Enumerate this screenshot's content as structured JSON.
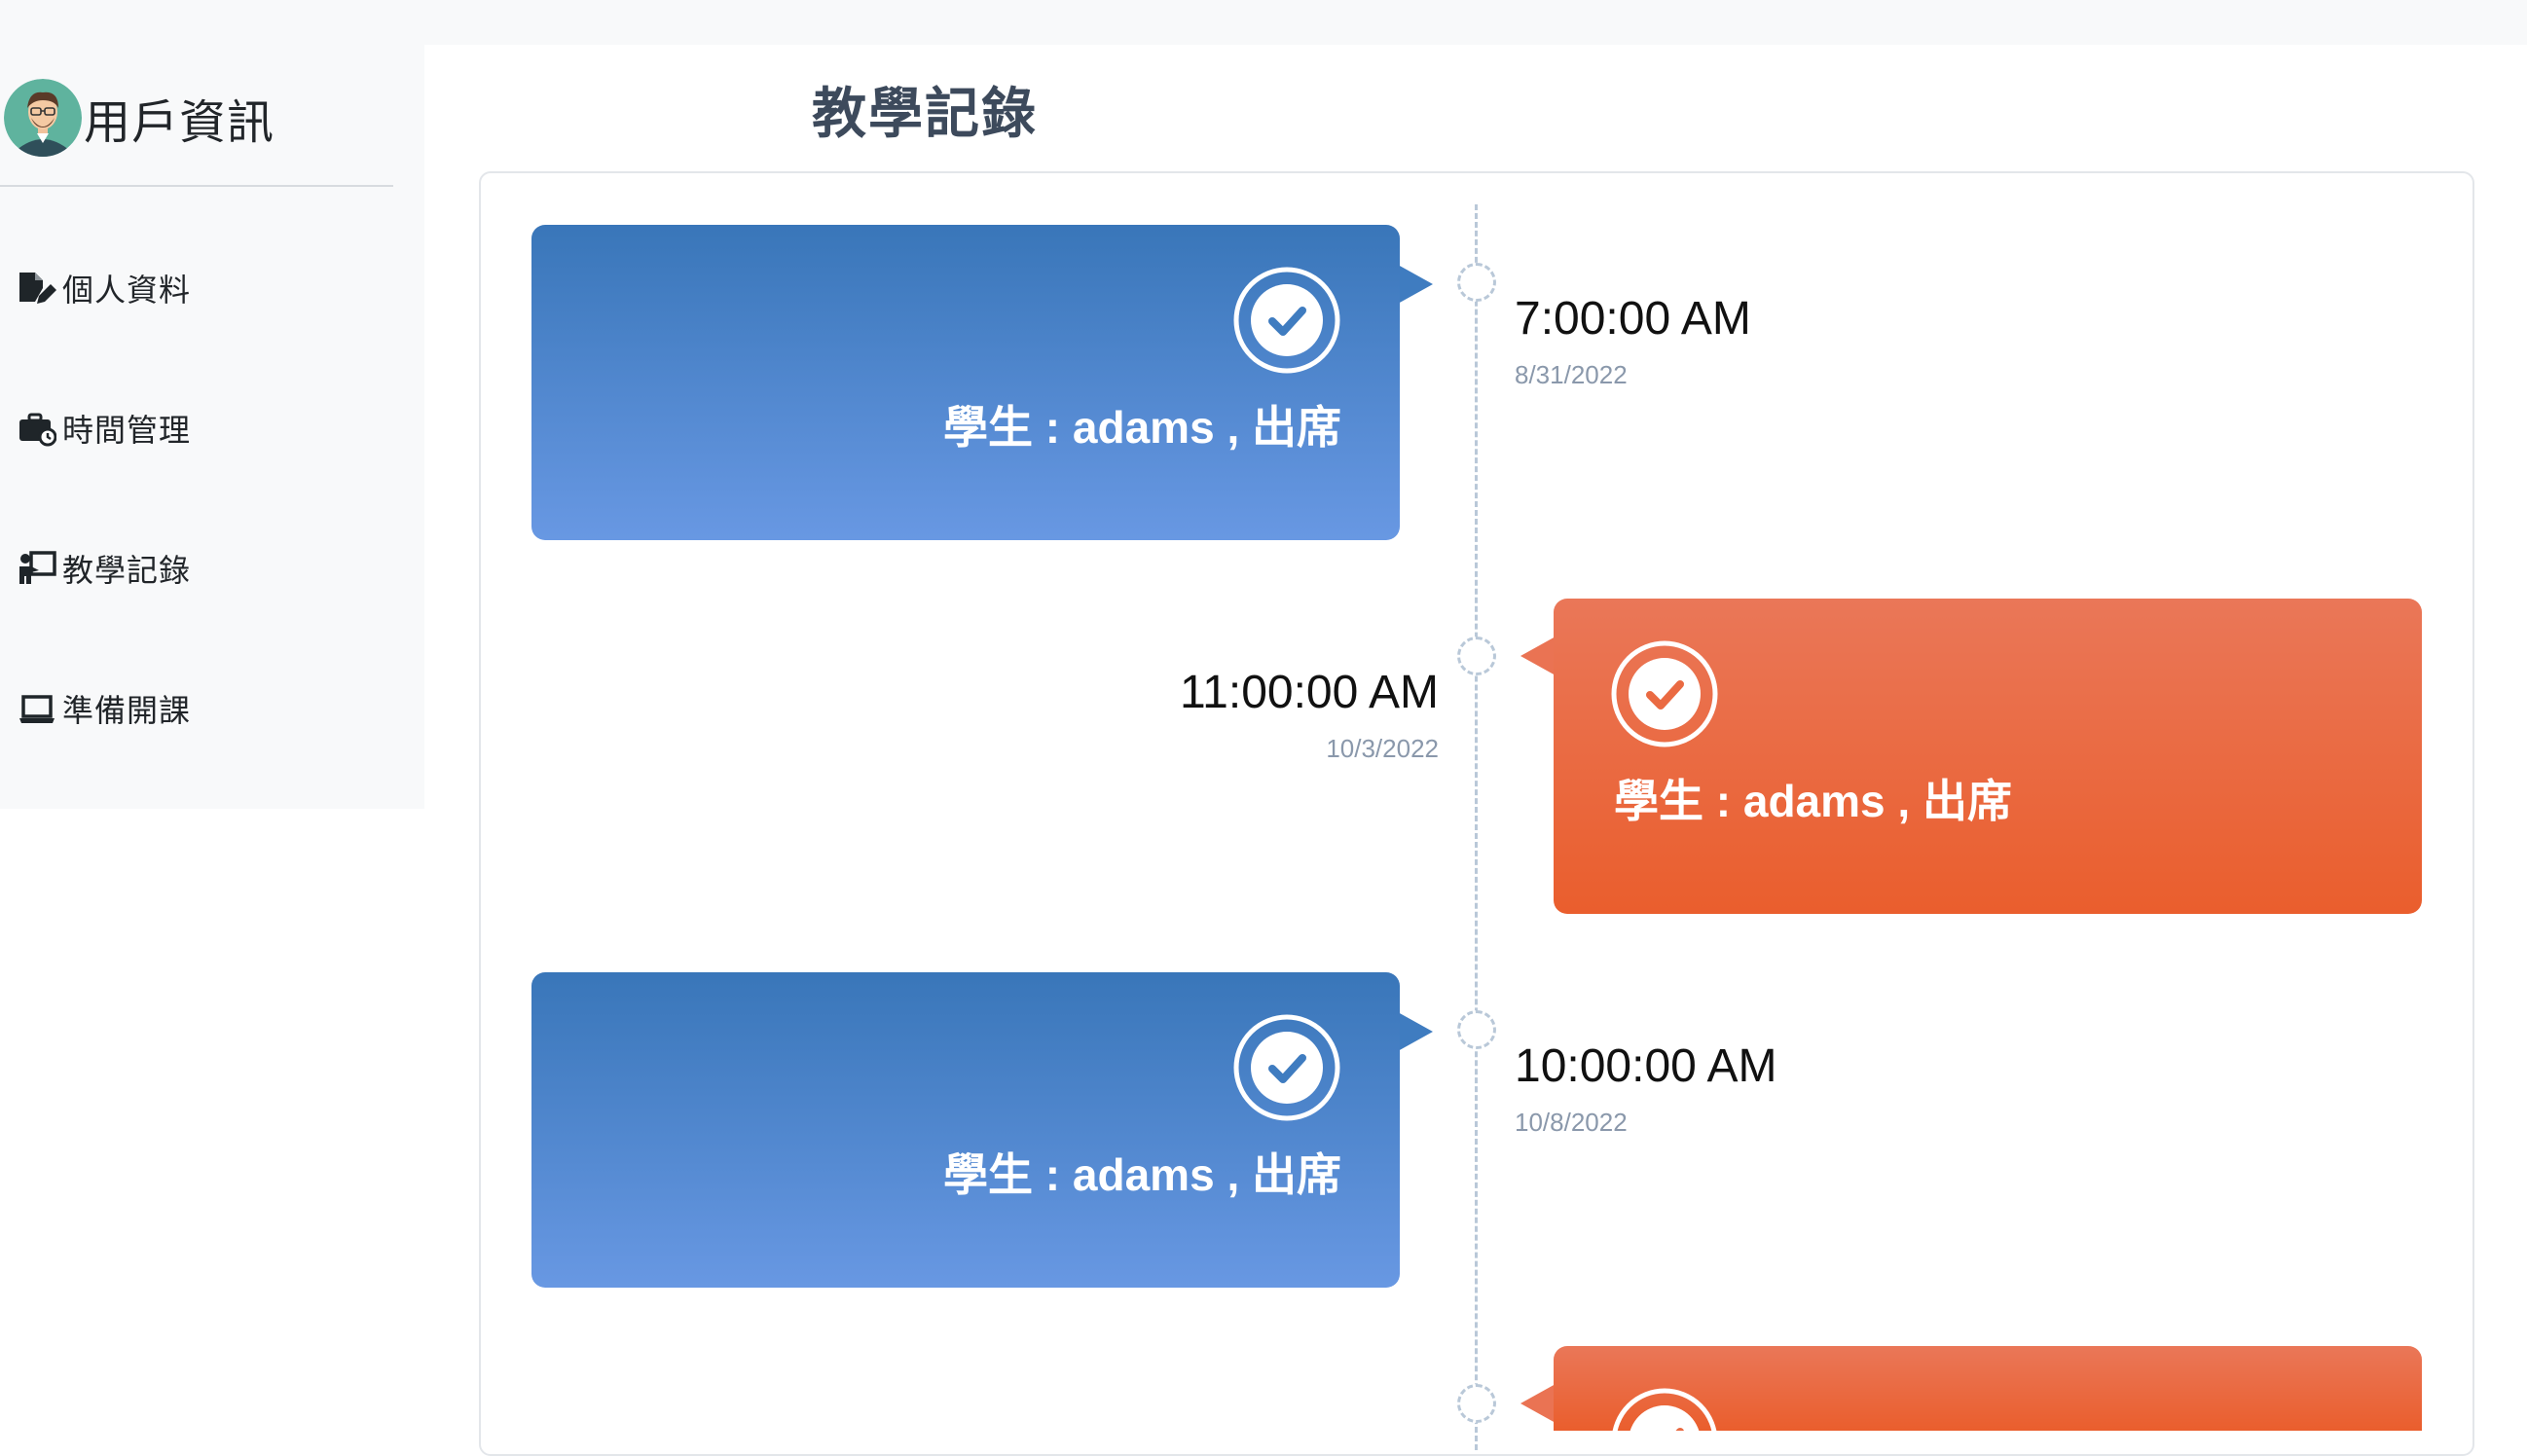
{
  "sidebar": {
    "title": "用戶資訊",
    "items": [
      {
        "label": "個人資料",
        "icon": "file-edit-icon"
      },
      {
        "label": "時間管理",
        "icon": "briefcase-clock-icon"
      },
      {
        "label": "教學記錄",
        "icon": "chalkboard-teacher-icon"
      },
      {
        "label": "準備開課",
        "icon": "laptop-icon"
      }
    ]
  },
  "main": {
    "title": "教學記錄",
    "timeline": [
      {
        "side": "left",
        "color": "blue",
        "text": "學生 : adams , 出席",
        "time": "7:00:00 AM",
        "date": "8/31/2022"
      },
      {
        "side": "right",
        "color": "orange",
        "text": "學生 : adams , 出席",
        "time": "11:00:00 AM",
        "date": "10/3/2022"
      },
      {
        "side": "left",
        "color": "blue",
        "text": "學生 : adams , 出席",
        "time": "10:00:00 AM",
        "date": "10/8/2022"
      },
      {
        "side": "right",
        "color": "orange",
        "text": "",
        "time": "",
        "date": ""
      }
    ]
  },
  "colors": {
    "blue_top": "#3976b9",
    "blue_bottom": "#6898e3",
    "orange_top": "#ea7758",
    "orange_bottom": "#ea5e2d",
    "title_text": "#3d4a5c",
    "date_text": "#8a98ab"
  }
}
